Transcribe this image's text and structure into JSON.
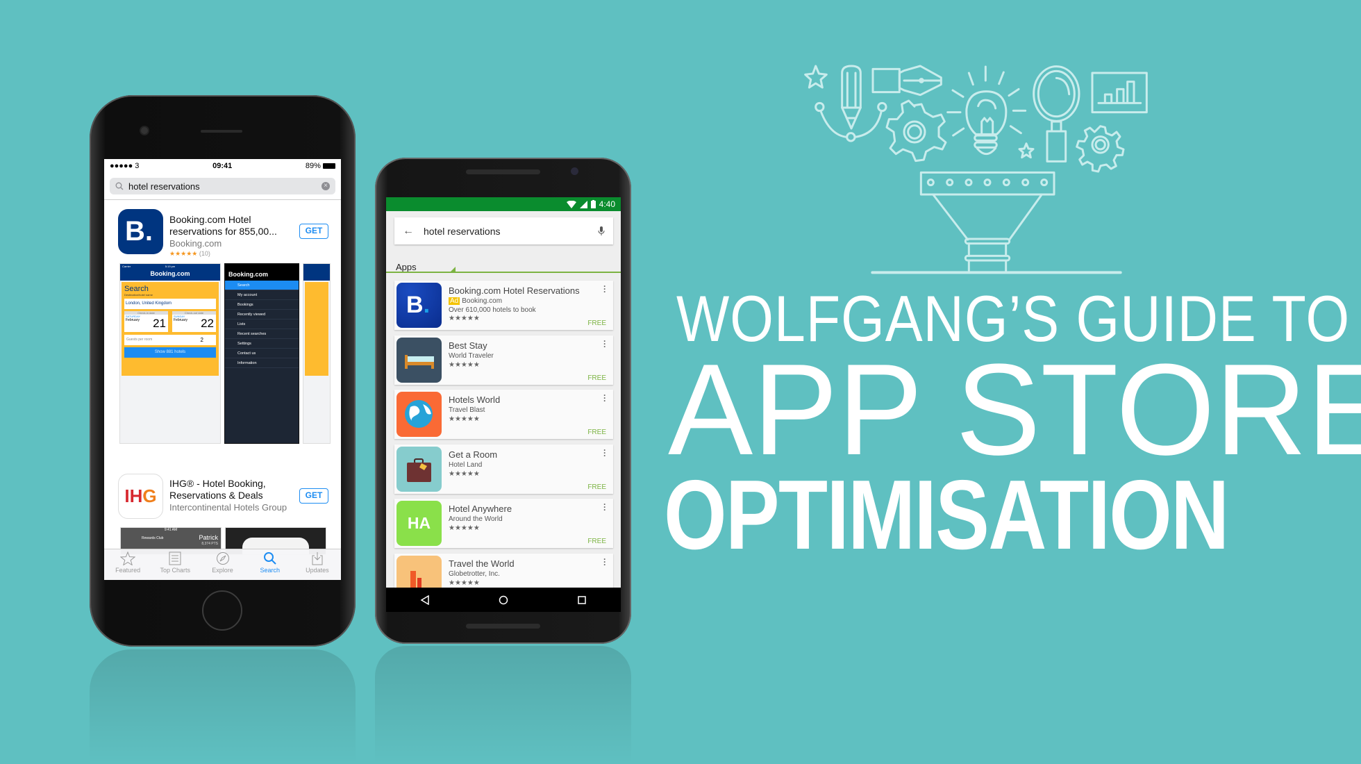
{
  "colors": {
    "background": "#5fc0c1",
    "illustration": "#c8ecec",
    "android_status": "#0a8c2e",
    "ios_accent": "#1c8cf2",
    "booking_blue": "#003580",
    "booking_yellow": "#febb2f",
    "free_green": "#7cb342"
  },
  "headline": {
    "line1": "WOLFGANG’S GUIDE TO",
    "line2": "APP STORE",
    "line3": "OPTIMISATION"
  },
  "ios": {
    "status": {
      "carrier": "●●●●● 3",
      "time": "09:41",
      "battery": "89%"
    },
    "search_query": "hotel reservations",
    "results": [
      {
        "title": "Booking.com Hotel reservations for 855,00...",
        "developer": "Booking.com",
        "stars": "★★★★★",
        "rating_count": "(10)",
        "button": "GET",
        "icon_text": "B."
      },
      {
        "title": "IHG® - Hotel Booking, Reservations & Deals",
        "developer": "Intercontinental Hotels Group",
        "button": "GET",
        "icon_text": "IHG"
      }
    ],
    "screenshot1": {
      "carrier": "Carrier",
      "time": "5:19 pm",
      "brand": "Booking.com",
      "search": "Search",
      "dest_label": "Destination/hotel name",
      "dest": "London, United Kingdom",
      "checkin_label": "Check-in date",
      "checkin_day": "SATURDAY",
      "checkin_month": "February",
      "checkin_date": "21",
      "checkout_label": "Check-out date",
      "checkout_day": "SUNDAY",
      "checkout_month": "February",
      "checkout_date": "22",
      "guests_label": "Guests per room",
      "guests": "2",
      "show_btn": "Show 881 hotels"
    },
    "screenshot2": {
      "brand": "Booking.com",
      "menu": [
        "Search",
        "My account",
        "Bookings",
        "Recently viewed",
        "Lists",
        "Recent searches",
        "Settings",
        "Contact us",
        "Information"
      ]
    },
    "ihg_shot": {
      "time": "9:41 AM",
      "club": "Rewards Club",
      "name": "Patrick",
      "points": "8,374 PTS"
    },
    "tabs": [
      {
        "label": "Featured",
        "icon": "star-icon"
      },
      {
        "label": "Top Charts",
        "icon": "list-icon"
      },
      {
        "label": "Explore",
        "icon": "compass-icon"
      },
      {
        "label": "Search",
        "icon": "search-icon",
        "active": true
      },
      {
        "label": "Updates",
        "icon": "download-icon"
      }
    ]
  },
  "android": {
    "status": {
      "time": "4:40"
    },
    "search_query": "hotel reservations",
    "section": "Apps",
    "results": [
      {
        "title": "Booking.com Hotel Reservations",
        "ad": "Ad",
        "developer": "Booking.com",
        "description": "Over 610,000 hotels to book",
        "stars": "★★★★★",
        "price": "FREE"
      },
      {
        "title": "Best Stay",
        "developer": "World Traveler",
        "stars": "★★★★★",
        "price": "FREE"
      },
      {
        "title": "Hotels World",
        "developer": "Travel Blast",
        "stars": "★★★★★",
        "price": "FREE"
      },
      {
        "title": "Get a Room",
        "developer": "Hotel Land",
        "stars": "★★★★★",
        "price": "FREE"
      },
      {
        "title": "Hotel Anywhere",
        "developer": "Around the World",
        "stars": "★★★★★",
        "price": "FREE",
        "icon_text": "HA"
      },
      {
        "title": "Travel the World",
        "developer": "Globetrotter, Inc.",
        "stars": "★★★★★"
      }
    ]
  }
}
